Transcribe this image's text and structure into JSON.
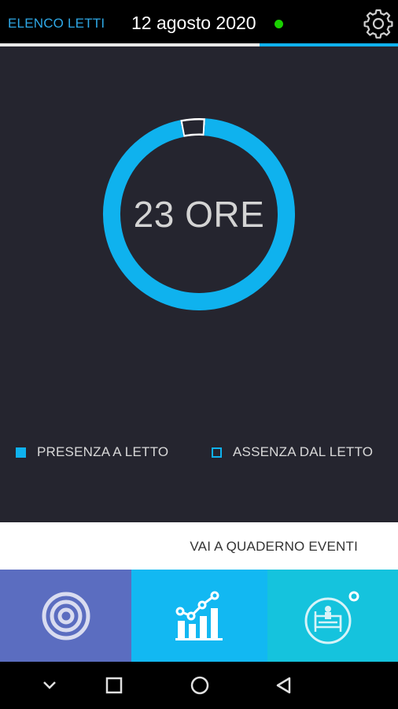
{
  "header": {
    "back_label": "ELENCO LETTI",
    "date": "12 agosto 2020",
    "status_color": "#19d000"
  },
  "colors": {
    "accent": "#0fb2ee",
    "panel_bg": "#25252f",
    "tab_1": "#5b6dc0",
    "tab_2": "#12b8f2",
    "tab_3": "#15c3dd"
  },
  "summary": {
    "hours_label": "23 ORE",
    "hours_present": 23,
    "hours_total": 24
  },
  "legend": {
    "present_label": "PRESENZA A LETTO",
    "absent_label": "ASSENZA DAL LETTO"
  },
  "events_link_label": "VAI A QUADERNO EVENTI",
  "tabs": [
    {
      "icon": "target-icon"
    },
    {
      "icon": "chart-trend-icon"
    },
    {
      "icon": "bed-patient-icon"
    }
  ],
  "system_nav": [
    {
      "icon": "chevron-down-icon"
    },
    {
      "icon": "recents-square-icon"
    },
    {
      "icon": "home-circle-icon"
    },
    {
      "icon": "back-triangle-icon"
    }
  ]
}
